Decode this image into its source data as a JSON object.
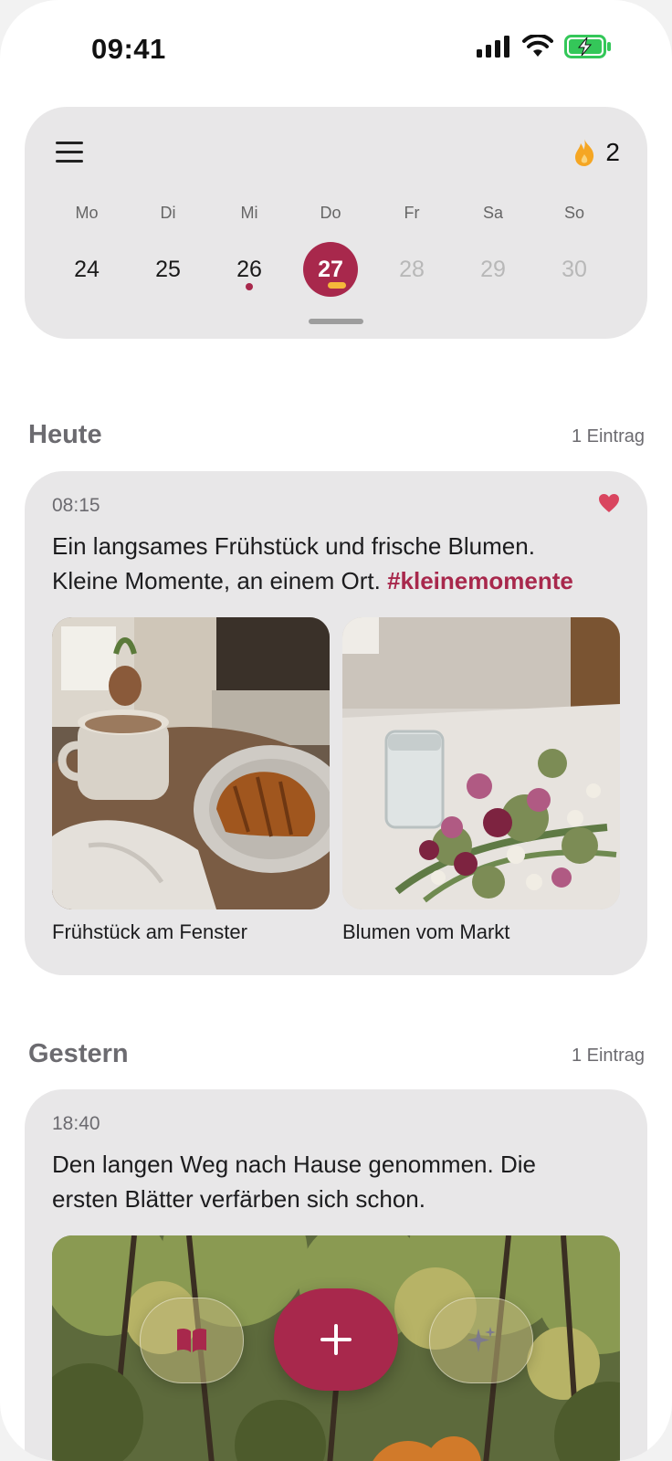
{
  "status_bar": {
    "time": "09:41"
  },
  "streak": {
    "count": "2"
  },
  "week": {
    "days": [
      {
        "wd": "Mo",
        "num": "24",
        "state": "past"
      },
      {
        "wd": "Di",
        "num": "25",
        "state": "past"
      },
      {
        "wd": "Mi",
        "num": "26",
        "state": "past",
        "has_entry": true
      },
      {
        "wd": "Do",
        "num": "27",
        "state": "selected"
      },
      {
        "wd": "Fr",
        "num": "28",
        "state": "future"
      },
      {
        "wd": "Sa",
        "num": "29",
        "state": "future"
      },
      {
        "wd": "So",
        "num": "30",
        "state": "future"
      }
    ]
  },
  "today": {
    "title": "Heute",
    "count": "1 Eintrag",
    "entry": {
      "time": "08:15",
      "text_line1": "Ein langsames Frühstück und frische Blumen.",
      "text_line2": "Kleine Momente, an einem Ort.",
      "hashtag": "#kleinemomente",
      "photos": [
        {
          "caption": "Frühstück am Fenster"
        },
        {
          "caption": "Blumen vom Markt"
        }
      ]
    }
  },
  "yesterday": {
    "title": "Gestern",
    "count": "1 Eintrag",
    "entry": {
      "time": "18:40",
      "text_line1": "Den langen Weg nach Hause genommen. Die",
      "text_line2": "ersten Blätter verfärben sich schon."
    }
  },
  "colors": {
    "accent": "#a8284c",
    "card": "#e8e7e8",
    "muted": "#6c6b70",
    "streak_flame": "#f5a623"
  },
  "icons": [
    "menu-icon",
    "flame-icon",
    "heart-icon",
    "book-icon",
    "plus-icon",
    "sparkles-icon"
  ]
}
